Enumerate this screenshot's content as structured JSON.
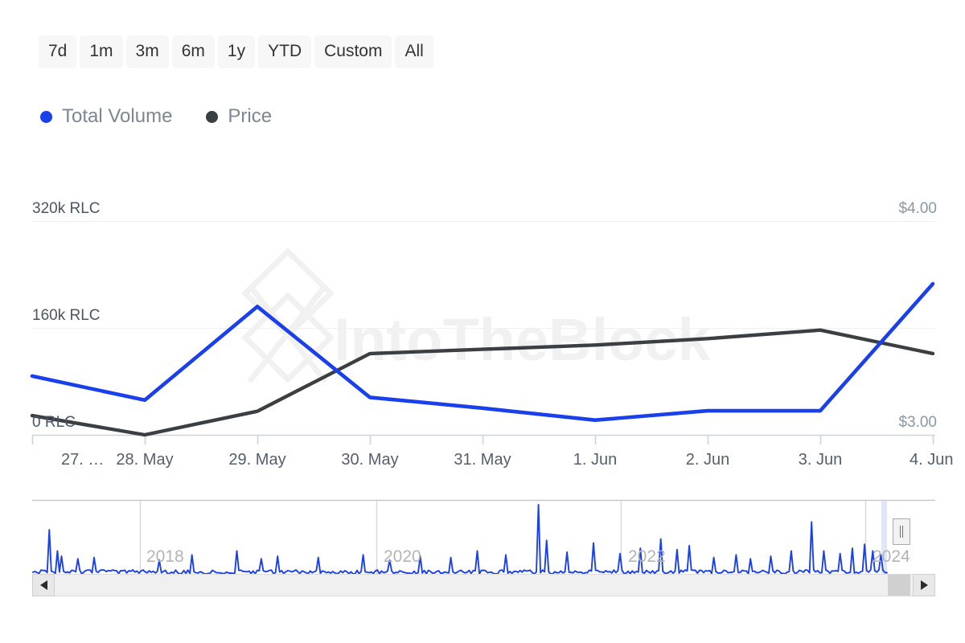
{
  "range_selector": {
    "buttons": [
      {
        "label": "7d",
        "selected": false
      },
      {
        "label": "1m",
        "selected": false
      },
      {
        "label": "3m",
        "selected": false
      },
      {
        "label": "6m",
        "selected": false
      },
      {
        "label": "1y",
        "selected": false
      },
      {
        "label": "YTD",
        "selected": false
      },
      {
        "label": "Custom",
        "selected": false
      },
      {
        "label": "All",
        "selected": false
      }
    ]
  },
  "legend": {
    "items": [
      {
        "label": "Total Volume",
        "color": "#1a40ec"
      },
      {
        "label": "Price",
        "color": "#3a3f44"
      }
    ]
  },
  "watermark": {
    "text": "IntoTheBlock"
  },
  "chart_data": {
    "type": "line",
    "title": "",
    "xlabel": "",
    "grid": true,
    "legend_position": "top-left",
    "categories": [
      "27. …",
      "28. May",
      "29. May",
      "30. May",
      "31. May",
      "1. Jun",
      "2. Jun",
      "3. Jun",
      "4. Jun"
    ],
    "axes": {
      "left": {
        "label": "Total Volume",
        "unit": "RLC",
        "ticks": [
          "0 RLC",
          "160k RLC",
          "320k RLC"
        ],
        "tick_values": [
          0,
          160000,
          320000
        ],
        "ylim": [
          0,
          320000
        ]
      },
      "right": {
        "label": "Price",
        "unit": "USD",
        "ticks": [
          "$3.00",
          "$4.00"
        ],
        "tick_values": [
          3.0,
          4.0
        ],
        "ylim": [
          2.63,
          4.0
        ]
      }
    },
    "series": [
      {
        "name": "Total Volume",
        "color": "#1a40ec",
        "axis": "left",
        "unit": "RLC",
        "values": [
          88000,
          52000,
          192000,
          56000,
          40000,
          22000,
          36000,
          36000,
          226000
        ]
      },
      {
        "name": "Price",
        "color": "#3a3f44",
        "axis": "right",
        "unit": "USD",
        "values": [
          3.09,
          3.0,
          3.11,
          3.38,
          3.4,
          3.42,
          3.45,
          3.49,
          3.38
        ]
      }
    ]
  },
  "navigator": {
    "year_labels": [
      "2018",
      "2020",
      "2022",
      "2024"
    ],
    "series_color": "#1a40ec",
    "scroll_left_icon": "triangle-left-icon",
    "scroll_right_icon": "triangle-right-icon",
    "handle_icon": "grip-handle-icon"
  }
}
